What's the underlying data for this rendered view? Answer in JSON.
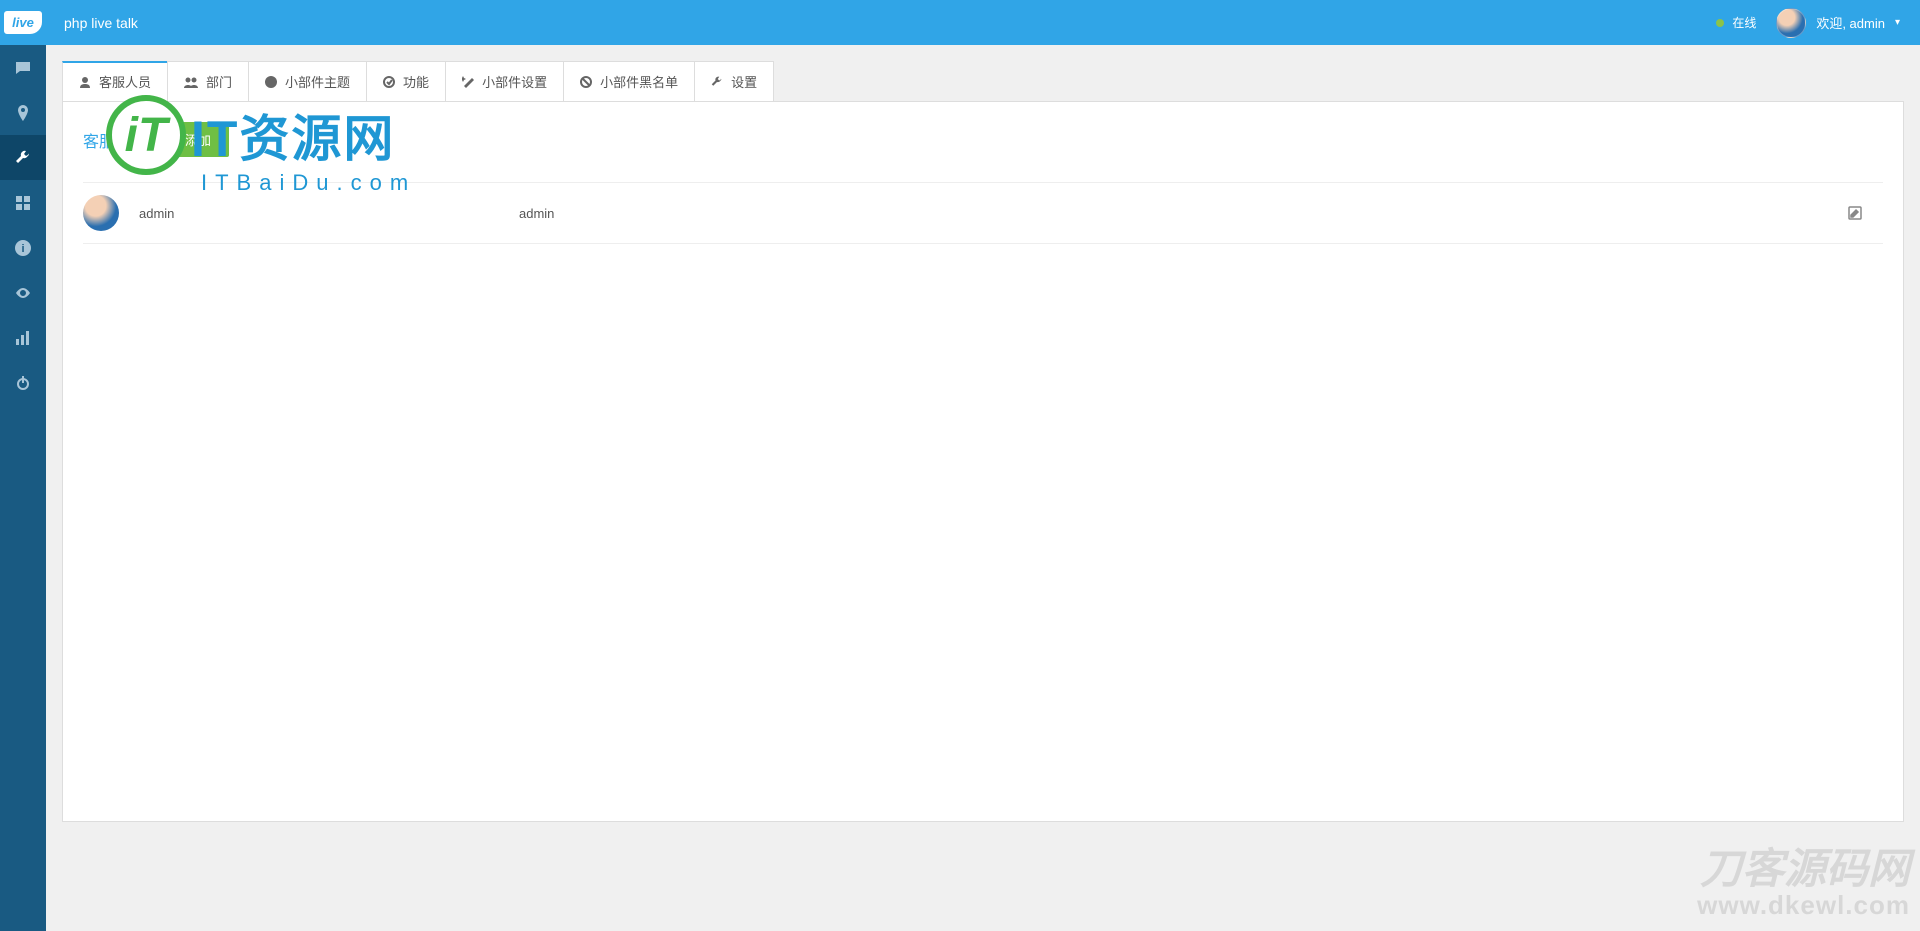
{
  "header": {
    "logo_text": "live",
    "app_title": "php live talk",
    "status_label": "在线",
    "user_welcome": "欢迎, admin"
  },
  "sidebar": {
    "items": [
      {
        "id": "chat",
        "icon": "chat-icon",
        "active": false
      },
      {
        "id": "location",
        "icon": "pin-icon",
        "active": false
      },
      {
        "id": "wrench",
        "icon": "wrench-icon",
        "active": true
      },
      {
        "id": "apps",
        "icon": "grid-icon",
        "active": false
      },
      {
        "id": "info",
        "icon": "info-icon",
        "active": false
      },
      {
        "id": "eye",
        "icon": "eye-icon",
        "active": false
      },
      {
        "id": "bars",
        "icon": "bars-icon",
        "active": false
      },
      {
        "id": "power",
        "icon": "power-icon",
        "active": false
      }
    ]
  },
  "tabs": [
    {
      "label": "客服人员",
      "icon": "user-icon",
      "active": true
    },
    {
      "label": "部门",
      "icon": "users-icon",
      "active": false
    },
    {
      "label": "小部件主题",
      "icon": "palette-icon",
      "active": false
    },
    {
      "label": "功能",
      "icon": "check-icon",
      "active": false
    },
    {
      "label": "小部件设置",
      "icon": "magic-icon",
      "active": false
    },
    {
      "label": "小部件黑名单",
      "icon": "ban-icon",
      "active": false
    },
    {
      "label": "设置",
      "icon": "wrench-icon",
      "active": false
    }
  ],
  "panel": {
    "title": "客服人员",
    "add_button": "添加"
  },
  "rows": [
    {
      "name": "admin",
      "user": "admin"
    }
  ],
  "watermark1": {
    "main": "IT资源网",
    "sub": "ITBaiDu.com"
  },
  "watermark2": {
    "main": "刀客源码网",
    "sub": "www.dkewl.com"
  }
}
